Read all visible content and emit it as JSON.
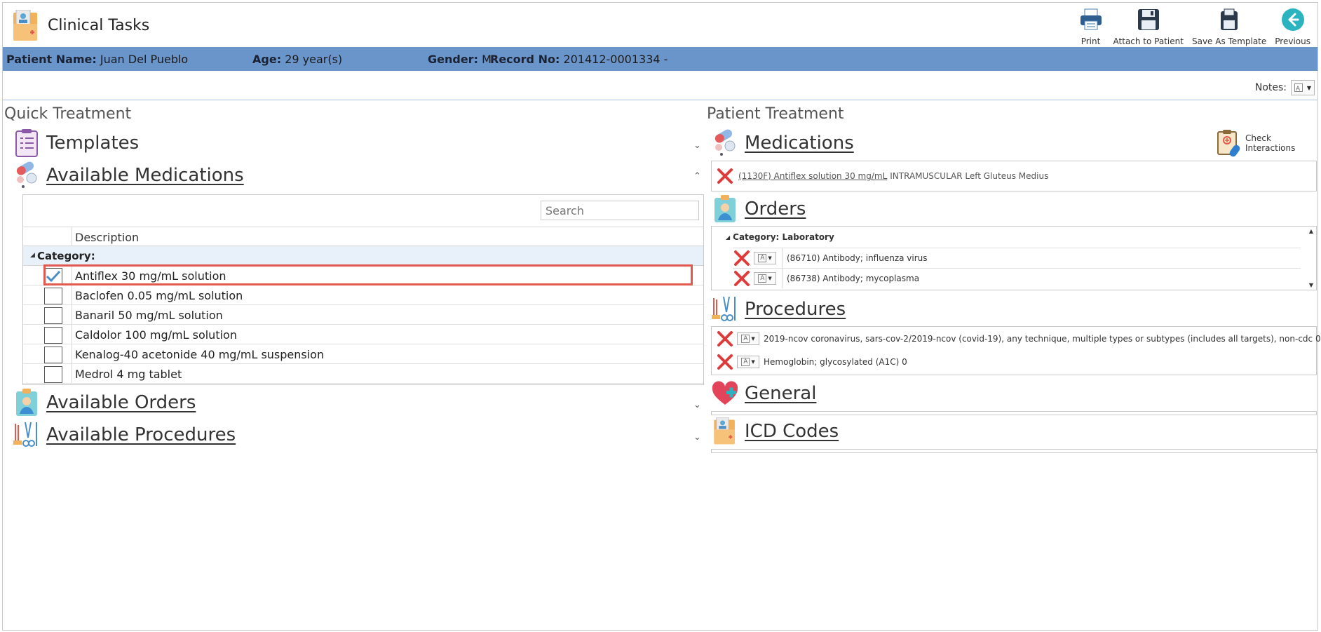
{
  "app": {
    "title": "Clinical Tasks",
    "icon": "clinical-folder-icon"
  },
  "toolbar": {
    "print_label": "Print",
    "attach_label": "Attach to Patient",
    "save_template_label": "Save As Template",
    "previous_label": "Previous"
  },
  "patient": {
    "name_label": "Patient Name:",
    "name_value": "Juan Del Pueblo",
    "age_label": "Age:",
    "age_value": "29 year(s)",
    "gender_label": "Gender:",
    "gender_value": "M",
    "record_label": "Record No:",
    "record_value": "201412-0001334 -"
  },
  "notes": {
    "label": "Notes:"
  },
  "quick_treatment": {
    "title": "Quick Treatment",
    "templates_label": "Templates",
    "available_medications_label": "Available Medications",
    "available_orders_label": "Available Orders",
    "available_procedures_label": "Available Procedures",
    "search_placeholder": "Search",
    "column_description": "Description",
    "category_label": "Category:",
    "medications": [
      {
        "name": "Antiflex 30 mg/mL solution",
        "checked": true
      },
      {
        "name": "Baclofen 0.05 mg/mL solution",
        "checked": false
      },
      {
        "name": "Banaril 50 mg/mL solution",
        "checked": false
      },
      {
        "name": "Caldolor 100 mg/mL solution",
        "checked": false
      },
      {
        "name": "Kenalog-40 acetonide 40 mg/mL suspension",
        "checked": false
      },
      {
        "name": "Medrol 4 mg tablet",
        "checked": false
      }
    ]
  },
  "patient_treatment": {
    "title": "Patient Treatment",
    "medications_label": "Medications",
    "check_interactions_label": "Check Interactions",
    "medication_entry": {
      "link": "(1130F) Antiflex solution 30 mg/mL",
      "detail": "INTRAMUSCULAR Left Gluteus Medius"
    },
    "orders_label": "Orders",
    "orders_category": "Category: Laboratory",
    "orders": [
      "(86710) Antibody; influenza virus",
      "(86738) Antibody; mycoplasma"
    ],
    "procedures_label": "Procedures",
    "procedures": [
      "2019-ncov coronavirus, sars-cov-2/2019-ncov (covid-19), any technique, multiple types or subtypes (includes all targets), non-cdc 0",
      "Hemoglobin; glycosylated (A1C) 0"
    ],
    "general_label": "General",
    "icd_label": "ICD Codes"
  },
  "colors": {
    "patient_bar": "#6a95cb",
    "highlight": "#e0584e",
    "delete_x": "#e03b3b",
    "previous_button": "#2bb3c0"
  }
}
